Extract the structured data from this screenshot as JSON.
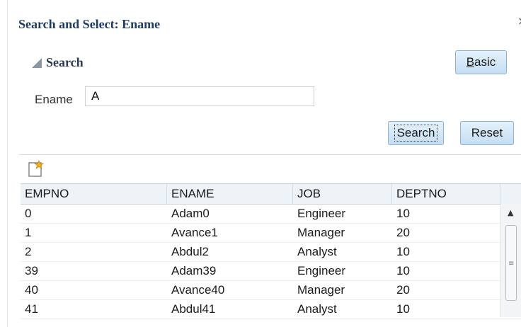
{
  "dialog": {
    "title": "Search and Select: Ename",
    "close_glyph": "×"
  },
  "search": {
    "header": "Search",
    "basic_button": {
      "accesskey": "B",
      "rest": "asic"
    },
    "field_label": "Ename",
    "field_value": "A",
    "search_button": "Search",
    "reset_button": "Reset"
  },
  "toolbar": {
    "add_icon": "new-record-icon"
  },
  "table": {
    "columns": [
      "EMPNO",
      "ENAME",
      "JOB",
      "DEPTNO"
    ],
    "rows": [
      [
        "0",
        "Adam0",
        "Engineer",
        "10"
      ],
      [
        "1",
        "Avance1",
        "Manager",
        "20"
      ],
      [
        "2",
        "Abdul2",
        "Analyst",
        "10"
      ],
      [
        "39",
        "Adam39",
        "Engineer",
        "10"
      ],
      [
        "40",
        "Avance40",
        "Manager",
        "20"
      ],
      [
        "41",
        "Abdul41",
        "Analyst",
        "10"
      ]
    ]
  },
  "colors": {
    "accent": "#1f3b63",
    "button_top": "#e4f1fb",
    "button_bottom": "#c5def3"
  }
}
